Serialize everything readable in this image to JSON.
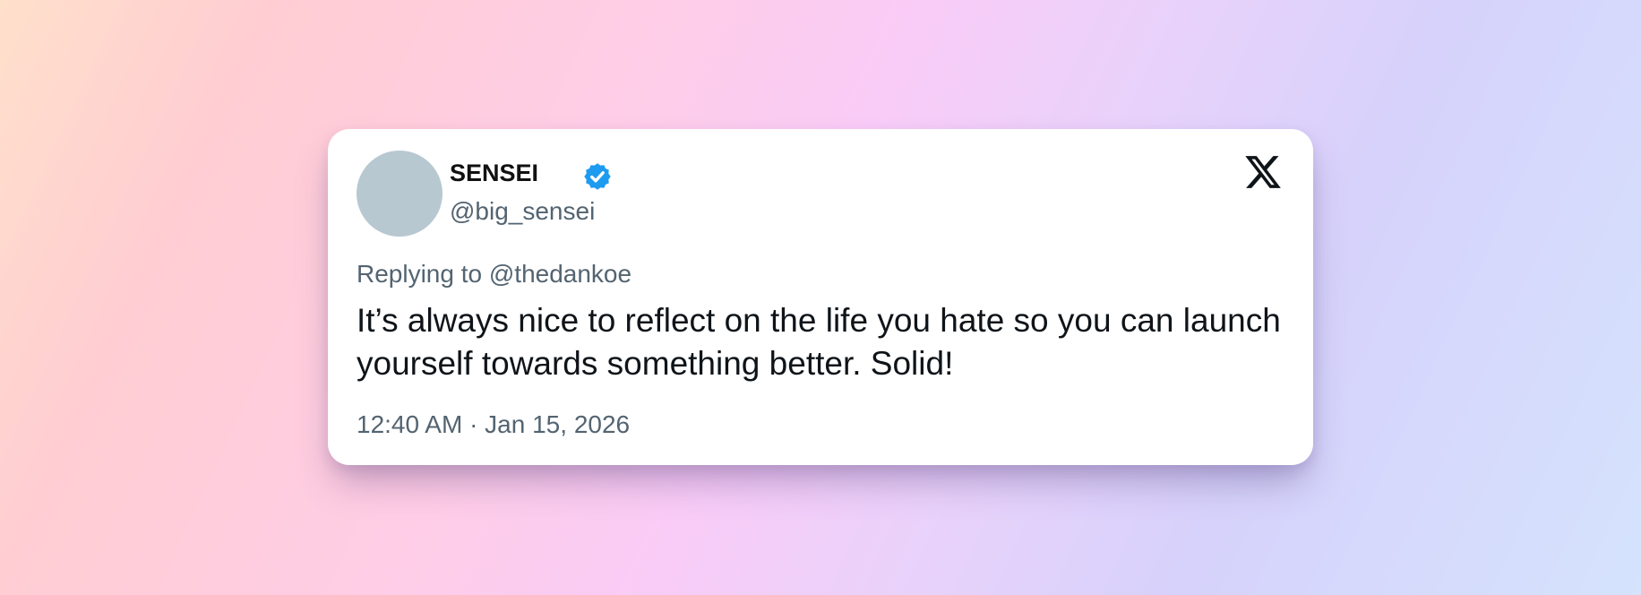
{
  "tweet": {
    "display_name": "SENSEI",
    "handle": "@big_sensei",
    "verified": true,
    "replying_to": "Replying to @thedankoe",
    "text": "It’s always nice to reflect on the life you hate so you can launch yourself towards something better. Solid!",
    "timestamp": "12:40 AM · Jan 15, 2026"
  },
  "icons": {
    "verified": "verified-badge-icon",
    "platform": "x-logo-icon"
  },
  "colors": {
    "verified_blue": "#1d9bf0",
    "secondary_text": "#536471",
    "primary_text": "#0f1419",
    "avatar_placeholder": "#b8c8d1"
  }
}
